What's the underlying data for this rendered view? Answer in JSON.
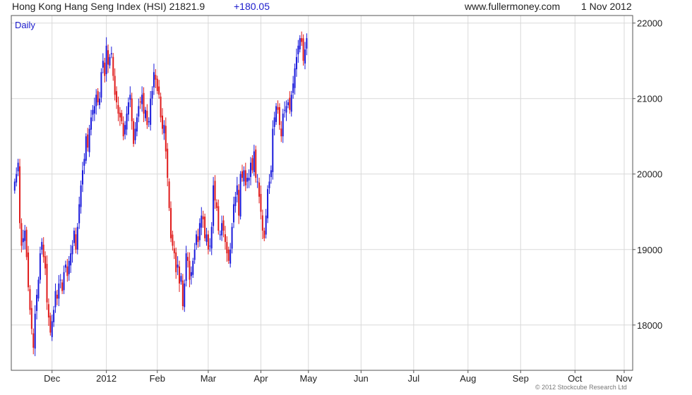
{
  "header": {
    "title": "Hong Kong Hang Seng Index (HSI) 21821.9",
    "change": "+180.05",
    "website": "www.fullermoney.com",
    "date": "1 Nov 2012"
  },
  "footer": {
    "copyright": "© 2012 Stockcube Research Ltd"
  },
  "colors": {
    "up": "#1a1adb",
    "down": "#e01b1b",
    "grid": "#d9d9d9",
    "axis": "#555555",
    "label_blue": "#1a1acc"
  },
  "chart_data": {
    "type": "candlestick",
    "period_label": "Daily",
    "title": "Hong Kong Hang Seng Index (HSI)",
    "y_axis_position": "right",
    "ylim": [
      17400,
      22100
    ],
    "yticks": [
      18000,
      19000,
      20000,
      21000,
      22000
    ],
    "ytick_labels": [
      "18000",
      "19000",
      "20000",
      "21000",
      "22000"
    ],
    "grid": true,
    "x_tick_labels": [
      "Dec",
      "2012",
      "Feb",
      "Mar",
      "Apr",
      "May",
      "Jun",
      "Jul",
      "Aug",
      "Sep",
      "Oct",
      "Nov"
    ],
    "x_tick_index": [
      22,
      54,
      84,
      114,
      145,
      173,
      204,
      235,
      267,
      298,
      330,
      359
    ],
    "xlim": [
      -2,
      364
    ],
    "closes": [
      19900,
      20000,
      20150,
      19350,
      19050,
      19150,
      19250,
      18900,
      18500,
      18200,
      17950,
      17700,
      18150,
      18400,
      18600,
      18950,
      19100,
      18900,
      18750,
      18300,
      18100,
      17900,
      18050,
      18200,
      18450,
      18350,
      18550,
      18600,
      18450,
      18700,
      18800,
      18650,
      18850,
      18950,
      19050,
      19250,
      19000,
      19300,
      19600,
      19850,
      20050,
      20200,
      20500,
      20350,
      20600,
      20750,
      20850,
      20900,
      21050,
      20950,
      21000,
      21350,
      21500,
      21300,
      21700,
      21450,
      21550,
      21600,
      21300,
      21050,
      20950,
      20800,
      20750,
      20700,
      20500,
      20650,
      20800,
      20950,
      21050,
      20700,
      20400,
      20600,
      20750,
      20900,
      20950,
      21050,
      20800,
      20850,
      20650,
      20700,
      21000,
      21100,
      21350,
      21250,
      21100,
      21050,
      20750,
      20600,
      20650,
      20300,
      19950,
      19550,
      19150,
      19050,
      18950,
      18700,
      18800,
      18550,
      18650,
      18250,
      18550,
      18950,
      18850,
      18600,
      18700,
      18850,
      19000,
      19200,
      19100,
      19350,
      19450,
      19400,
      19150,
      19200,
      19000,
      19050,
      19300,
      19850,
      19650,
      19550,
      19250,
      19200,
      19350,
      19250,
      19100,
      18950,
      18850,
      19000,
      19300,
      19600,
      19700,
      19850,
      19450,
      20000,
      19950,
      20050,
      19850,
      19950,
      19950,
      20150,
      20050,
      20300,
      19950,
      19900,
      19700,
      19500,
      19250,
      19150,
      19450,
      19800,
      19900,
      20050,
      20600,
      20750,
      20900,
      20850,
      20650,
      20500,
      20800,
      20850,
      20900,
      20950,
      20850,
      21050,
      21200,
      21400,
      21550,
      21700,
      21800,
      21750,
      21500,
      21650,
      21800
    ],
    "ohlc_note": "candles: blue = close above open, red = close below open"
  }
}
